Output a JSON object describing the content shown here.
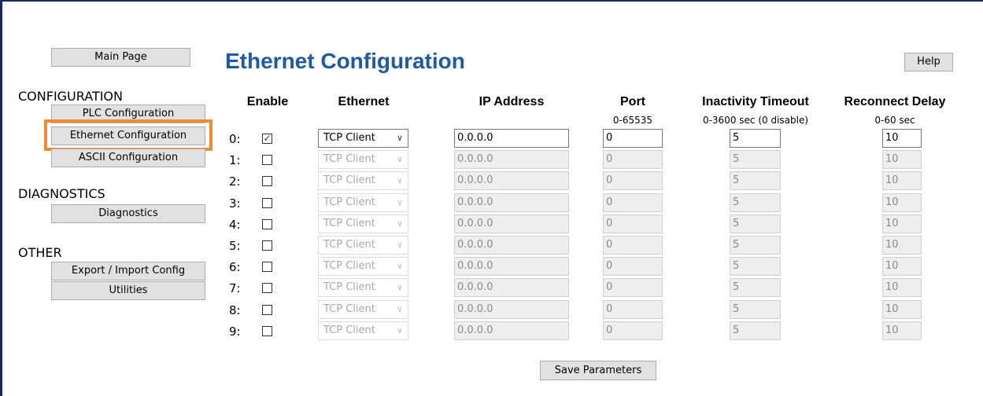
{
  "nav": {
    "main_page": "Main Page",
    "configuration_heading": "CONFIGURATION",
    "plc_config": "PLC Configuration",
    "ethernet_config": "Ethernet Configuration",
    "ascii_config": "ASCII Configuration",
    "diagnostics_heading": "DIAGNOSTICS",
    "diagnostics": "Diagnostics",
    "other_heading": "OTHER",
    "export_import": "Export / Import Config",
    "utilities": "Utilities",
    "active_item": "Ethernet Configuration",
    "highlight_color": "#f28a2e"
  },
  "page": {
    "title": "Ethernet Configuration",
    "title_color": "#1f5aa3",
    "help": "Help",
    "save": "Save Parameters"
  },
  "table": {
    "headers": {
      "enable": "Enable",
      "ethernet": "Ethernet",
      "ip": "IP Address",
      "port": "Port",
      "port_range": "0-65535",
      "timeout": "Inactivity Timeout",
      "timeout_range": "0-3600 sec (0 disable)",
      "reconnect": "Reconnect Delay",
      "reconnect_range": "0-60 sec"
    },
    "rows": [
      {
        "idx": "0:",
        "enabled": true,
        "ethernet": "TCP Client",
        "ip": "0.0.0.0",
        "port": "0",
        "timeout": "5",
        "reconnect": "10"
      },
      {
        "idx": "1:",
        "enabled": false,
        "ethernet": "TCP Client",
        "ip": "0.0.0.0",
        "port": "0",
        "timeout": "5",
        "reconnect": "10"
      },
      {
        "idx": "2:",
        "enabled": false,
        "ethernet": "TCP Client",
        "ip": "0.0.0.0",
        "port": "0",
        "timeout": "5",
        "reconnect": "10"
      },
      {
        "idx": "3:",
        "enabled": false,
        "ethernet": "TCP Client",
        "ip": "0.0.0.0",
        "port": "0",
        "timeout": "5",
        "reconnect": "10"
      },
      {
        "idx": "4:",
        "enabled": false,
        "ethernet": "TCP Client",
        "ip": "0.0.0.0",
        "port": "0",
        "timeout": "5",
        "reconnect": "10"
      },
      {
        "idx": "5:",
        "enabled": false,
        "ethernet": "TCP Client",
        "ip": "0.0.0.0",
        "port": "0",
        "timeout": "5",
        "reconnect": "10"
      },
      {
        "idx": "6:",
        "enabled": false,
        "ethernet": "TCP Client",
        "ip": "0.0.0.0",
        "port": "0",
        "timeout": "5",
        "reconnect": "10"
      },
      {
        "idx": "7:",
        "enabled": false,
        "ethernet": "TCP Client",
        "ip": "0.0.0.0",
        "port": "0",
        "timeout": "5",
        "reconnect": "10"
      },
      {
        "idx": "8:",
        "enabled": false,
        "ethernet": "TCP Client",
        "ip": "0.0.0.0",
        "port": "0",
        "timeout": "5",
        "reconnect": "10"
      },
      {
        "idx": "9:",
        "enabled": false,
        "ethernet": "TCP Client",
        "ip": "0.0.0.0",
        "port": "0",
        "timeout": "5",
        "reconnect": "10"
      }
    ]
  }
}
